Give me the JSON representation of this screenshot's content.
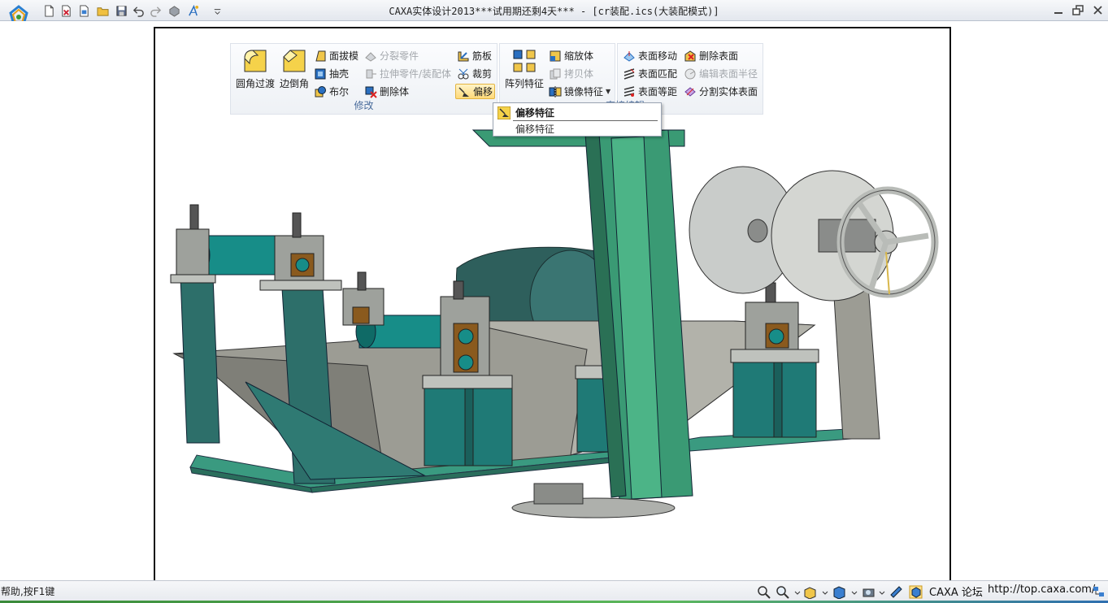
{
  "window": {
    "title": "CAXA实体设计2013***试用期还剩4天*** - [cr装配.ics(大装配模式)]"
  },
  "quick_access": [
    {
      "icon": "new-file-icon"
    },
    {
      "icon": "close-file-icon"
    },
    {
      "icon": "open-recent-icon"
    },
    {
      "icon": "open-folder-icon"
    },
    {
      "icon": "save-icon"
    },
    {
      "icon": "undo-icon"
    },
    {
      "icon": "redo-icon"
    },
    {
      "icon": "render-icon"
    },
    {
      "icon": "design-wizard-icon"
    },
    {
      "icon": "customize-dropdown-icon"
    }
  ],
  "ribbon": {
    "modify": {
      "label": "修改",
      "fillet": "圆角过渡",
      "chamfer": "边倒角",
      "draft": "面拔模",
      "shell": "抽壳",
      "boolean": "布尔",
      "split_part": "分裂零件",
      "stretch_part": "拉伸零件/装配体",
      "delete_body": "删除体",
      "rib": "筋板",
      "trim": "裁剪",
      "offset": "偏移"
    },
    "pattern": {
      "array": "阵列特征",
      "scale_body": "缩放体",
      "copy_body": "拷贝体",
      "mirror_feature": "镜像特征"
    },
    "direct_edit": {
      "label": "直接编辑",
      "move_face": "表面移动",
      "match_face": "表面匹配",
      "offset_face": "表面等距",
      "delete_face": "删除表面",
      "edit_radius": "编辑表面半径",
      "split_face": "分割实体表面"
    }
  },
  "tooltip": {
    "title": "偏移特征",
    "description": "偏移特征"
  },
  "status": {
    "help_text": "帮助,按F1键",
    "forum": "CAXA 论坛",
    "url": "http://top.caxa.com/"
  },
  "colors": {
    "teal_body": "#2e8a84",
    "frame_green": "#3a9a74",
    "gray_plate": "#9c9c94",
    "bracket": "#8a5a1e",
    "accent_hover": "#ffd978"
  }
}
